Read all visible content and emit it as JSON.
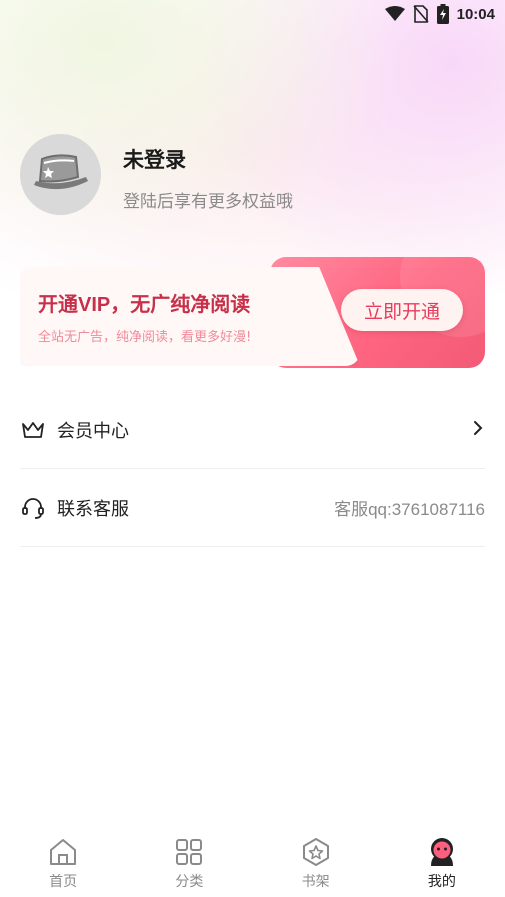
{
  "status_bar": {
    "time": "10:04",
    "icons": [
      "wifi-icon",
      "no-sim-icon",
      "battery-charging-icon"
    ]
  },
  "profile": {
    "name": "未登录",
    "subtitle": "登陆后享有更多权益哦",
    "avatar_icon": "hat-book-icon"
  },
  "vip_banner": {
    "title": "开通VIP，无广纯净阅读",
    "description": "全站无广告，纯净阅读，看更多好漫!",
    "button_label": "立即开通",
    "accent": "#ff6580"
  },
  "menu": [
    {
      "label": "会员中心",
      "icon": "crown-icon",
      "right_icon": "chevron-right-icon"
    },
    {
      "label": "联系客服",
      "icon": "headset-icon",
      "right_text": "客服qq:3761087116"
    }
  ],
  "bottom_nav": {
    "active": "我的",
    "items": [
      {
        "label": "首页",
        "icon": "home-icon"
      },
      {
        "label": "分类",
        "icon": "grid-icon"
      },
      {
        "label": "书架",
        "icon": "star-hexagon-icon"
      },
      {
        "label": "我的",
        "icon": "profile-face-icon"
      }
    ]
  }
}
